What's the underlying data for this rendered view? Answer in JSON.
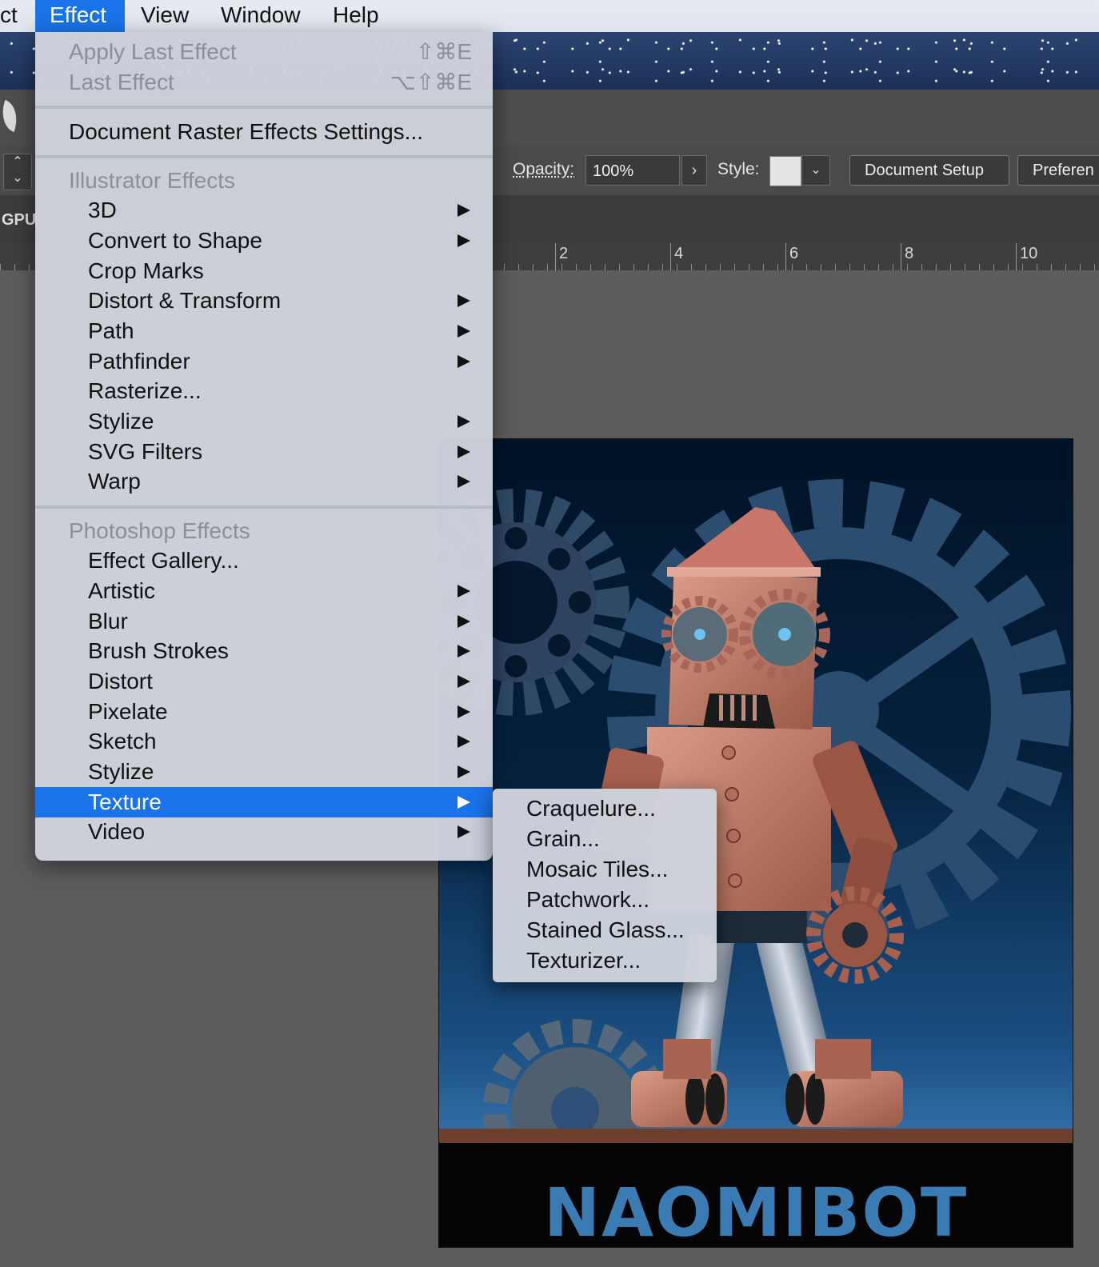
{
  "menubar": {
    "items": [
      {
        "label": "ct",
        "active": false
      },
      {
        "label": "Effect",
        "active": true
      },
      {
        "label": "View",
        "active": false
      },
      {
        "label": "Window",
        "active": false
      },
      {
        "label": "Help",
        "active": false
      }
    ]
  },
  "toolbar": {
    "opacity_label": "Opacity:",
    "opacity_value": "100%",
    "style_label": "Style:",
    "document_setup": "Document Setup",
    "preferences": "Preferen"
  },
  "gpu_label": "GPU",
  "ruler": {
    "labels": [
      "2",
      "4",
      "6",
      "8",
      "10"
    ]
  },
  "artwork": {
    "title": "NAOMIBOT"
  },
  "effect_menu": {
    "apply_last": {
      "label": "Apply Last Effect",
      "shortcut": "⇧⌘E"
    },
    "last": {
      "label": "Last Effect",
      "shortcut": "⌥⇧⌘E"
    },
    "raster_settings": "Document Raster Effects Settings...",
    "illustrator_heading": "Illustrator Effects",
    "illustrator_items": [
      "3D",
      "Convert to Shape",
      "Crop Marks",
      "Distort & Transform",
      "Path",
      "Pathfinder",
      "Rasterize...",
      "Stylize",
      "SVG Filters",
      "Warp"
    ],
    "photoshop_heading": "Photoshop Effects",
    "photoshop_items": [
      "Effect Gallery...",
      "Artistic",
      "Blur",
      "Brush Strokes",
      "Distort",
      "Pixelate",
      "Sketch",
      "Stylize",
      "Texture",
      "Video"
    ],
    "highlighted": "Texture"
  },
  "texture_submenu": {
    "items": [
      "Craquelure...",
      "Grain...",
      "Mosaic Tiles...",
      "Patchwork...",
      "Stained Glass...",
      "Texturizer..."
    ]
  },
  "colors": {
    "highlight": "#1a73e8",
    "menu_bg": "#ced3dc",
    "title_blue": "#3b7bb4",
    "robot_copper": "#c9836f"
  }
}
